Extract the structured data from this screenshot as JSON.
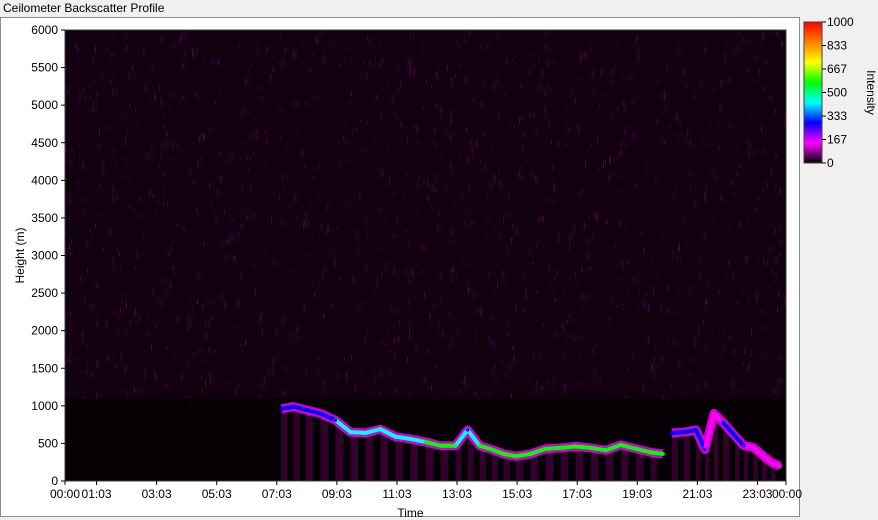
{
  "window": {
    "title": "Ceilometer Backscatter Profile"
  },
  "colors": {
    "background": "#000000",
    "ramp": [
      "#000000",
      "#ff00ff",
      "#0000ff",
      "#00ffff",
      "#00ff00",
      "#ffff00",
      "#ff8000",
      "#ff0000"
    ]
  },
  "chart_data": {
    "type": "heatmap",
    "title": "Ceilometer Backscatter Profile",
    "xlabel": "Time",
    "ylabel": "Height (m)",
    "x_ticks": [
      "00:00",
      "01:03",
      "03:03",
      "05:03",
      "07:03",
      "09:03",
      "11:03",
      "13:03",
      "15:03",
      "17:03",
      "19:03",
      "21:03",
      "23:03",
      "00:00"
    ],
    "x_tick_hours": [
      0,
      1.05,
      3.05,
      5.05,
      7.05,
      9.05,
      11.05,
      13.05,
      15.05,
      17.05,
      19.05,
      21.05,
      23.05,
      24
    ],
    "xlim_hours": [
      0,
      24
    ],
    "ylim": [
      0,
      6000
    ],
    "y_ticks": [
      0,
      500,
      1000,
      1500,
      2000,
      2500,
      3000,
      3500,
      4000,
      4500,
      5000,
      5500,
      6000
    ],
    "colorbar": {
      "label": "Intensity",
      "range": [
        0,
        1000
      ],
      "ticks": [
        0,
        167,
        333,
        500,
        667,
        833,
        1000
      ]
    },
    "cloud_layer": {
      "time_hours": [
        7.2,
        7.6,
        8.0,
        8.5,
        9.0,
        9.5,
        10.0,
        10.5,
        11.0,
        11.5,
        12.0,
        12.5,
        13.0,
        13.4,
        13.8,
        14.2,
        14.6,
        15.0,
        15.5,
        16.0,
        16.5,
        17.0,
        17.5,
        18.0,
        18.5,
        19.0,
        19.5,
        19.9
      ],
      "height_m": [
        960,
        990,
        950,
        900,
        810,
        650,
        640,
        690,
        590,
        560,
        520,
        470,
        470,
        680,
        470,
        420,
        360,
        330,
        360,
        430,
        440,
        460,
        440,
        410,
        480,
        430,
        380,
        360
      ],
      "intensity": [
        300,
        300,
        280,
        300,
        350,
        380,
        400,
        450,
        480,
        480,
        500,
        500,
        520,
        350,
        520,
        540,
        560,
        560,
        540,
        530,
        540,
        560,
        560,
        560,
        560,
        570,
        560,
        520
      ]
    },
    "late_layer": {
      "time_hours": [
        20.2,
        20.6,
        21.0,
        21.3,
        21.6,
        21.9,
        22.3,
        22.6,
        22.9,
        23.2,
        23.5,
        23.8
      ],
      "height_m": [
        640,
        650,
        680,
        420,
        900,
        780,
        600,
        470,
        450,
        350,
        250,
        200
      ],
      "intensity": [
        250,
        230,
        250,
        220,
        200,
        220,
        230,
        220,
        200,
        200,
        180,
        160
      ]
    }
  }
}
